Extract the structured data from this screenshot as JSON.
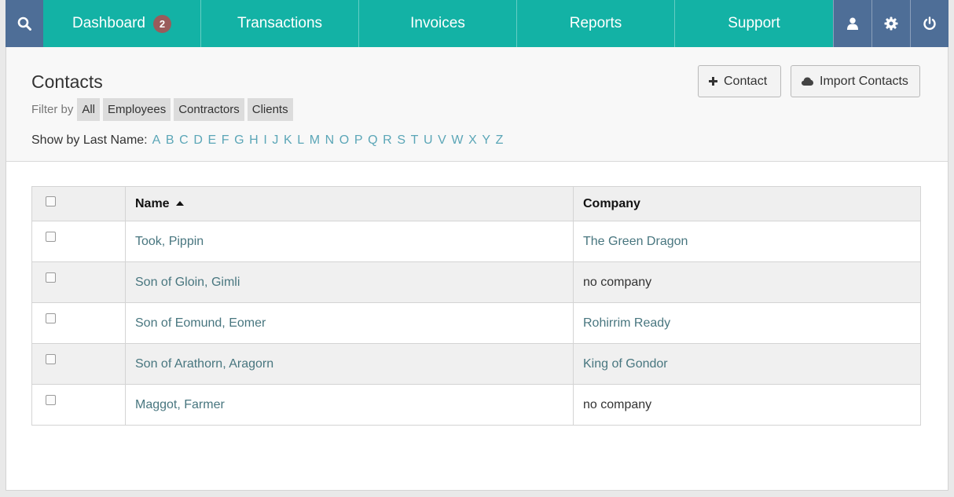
{
  "nav": {
    "tabs": [
      {
        "label": "Dashboard",
        "badge": "2"
      },
      {
        "label": "Transactions"
      },
      {
        "label": "Invoices"
      },
      {
        "label": "Reports"
      },
      {
        "label": "Support"
      }
    ],
    "icons": [
      "search-icon",
      "user-icon",
      "gear-icon",
      "power-icon"
    ],
    "colors": {
      "teal": "#13b2a5",
      "slate": "#4e6e97",
      "badge": "#9a5b5b"
    }
  },
  "header": {
    "title": "Contacts",
    "filter_label": "Filter by",
    "filters": [
      "All",
      "Employees",
      "Contractors",
      "Clients"
    ],
    "letters_label": "Show by Last Name:",
    "letters": [
      "A",
      "B",
      "C",
      "D",
      "E",
      "F",
      "G",
      "H",
      "I",
      "J",
      "K",
      "L",
      "M",
      "N",
      "O",
      "P",
      "Q",
      "R",
      "S",
      "T",
      "U",
      "V",
      "W",
      "X",
      "Y",
      "Z"
    ],
    "add_contact_label": "Contact",
    "import_label": "Import Contacts"
  },
  "table": {
    "columns": {
      "name": "Name",
      "company": "Company"
    },
    "rows": [
      {
        "name": "Took, Pippin",
        "company": "The Green Dragon",
        "company_link": true
      },
      {
        "name": "Son of Gloin, Gimli",
        "company": "no company",
        "company_link": false
      },
      {
        "name": "Son of Eomund, Eomer",
        "company": "Rohirrim Ready",
        "company_link": true
      },
      {
        "name": "Son of Arathorn, Aragorn",
        "company": "King of Gondor",
        "company_link": true
      },
      {
        "name": "Maggot, Farmer",
        "company": "no company",
        "company_link": false
      }
    ]
  }
}
